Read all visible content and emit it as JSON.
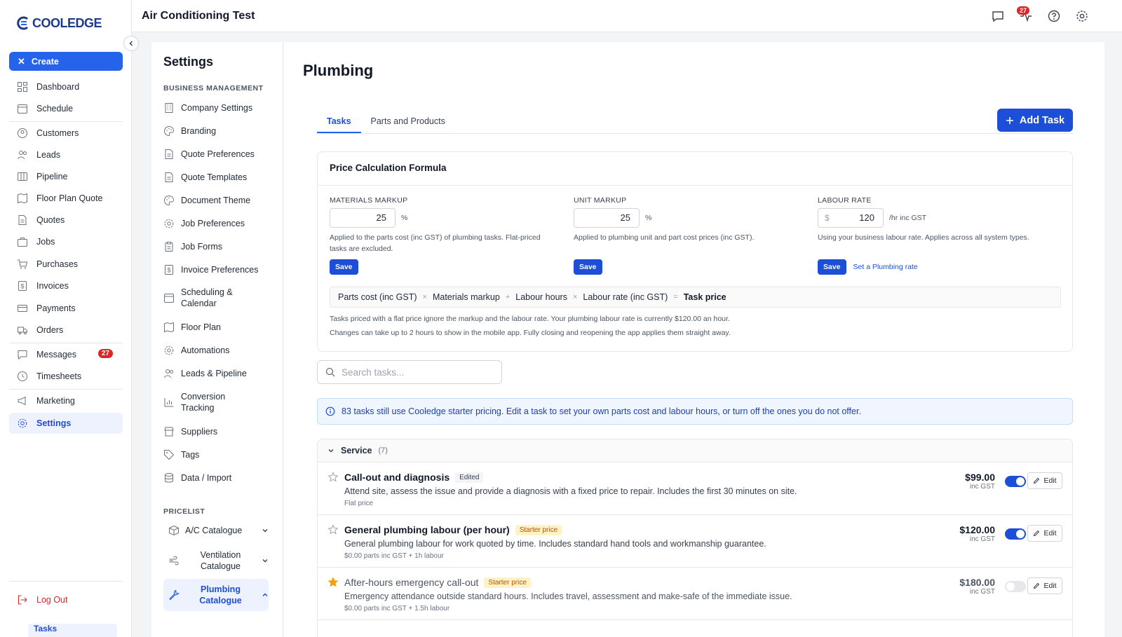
{
  "app": {
    "logo_text": "COOLEDGE",
    "title": "Air Conditioning Test",
    "messages_count": "27"
  },
  "sidebar": {
    "create_label": "Create",
    "items": [
      {
        "label": "Dashboard",
        "icon": "dashboard-icon"
      },
      {
        "label": "Schedule",
        "icon": "calendar-icon"
      },
      {
        "label": "Customers",
        "icon": "user-circle-icon"
      },
      {
        "label": "Leads",
        "icon": "users-icon"
      },
      {
        "label": "Pipeline",
        "icon": "pipeline-icon"
      },
      {
        "label": "Floor Plan Quote",
        "icon": "map-icon"
      },
      {
        "label": "Quotes",
        "icon": "document-icon"
      },
      {
        "label": "Jobs",
        "icon": "briefcase-icon"
      },
      {
        "label": "Purchases",
        "icon": "cart-icon"
      },
      {
        "label": "Invoices",
        "icon": "invoice-icon"
      },
      {
        "label": "Payments",
        "icon": "credit-card-icon"
      },
      {
        "label": "Orders",
        "icon": "truck-icon"
      },
      {
        "label": "Messages",
        "icon": "chat-icon",
        "badge": "27"
      },
      {
        "label": "Timesheets",
        "icon": "clock-icon"
      },
      {
        "label": "Marketing",
        "icon": "megaphone-icon"
      },
      {
        "label": "Settings",
        "icon": "gear-icon"
      }
    ],
    "logout_label": "Log Out"
  },
  "settings_panel": {
    "title": "Settings",
    "business_section": "BUSINESS MANAGEMENT",
    "items": [
      {
        "label": "Company Settings"
      },
      {
        "label": "Branding"
      },
      {
        "label": "Quote Preferences"
      },
      {
        "label": "Quote Templates"
      },
      {
        "label": "Document Theme"
      },
      {
        "label": "Job Preferences"
      },
      {
        "label": "Job Forms"
      },
      {
        "label": "Invoice Preferences"
      },
      {
        "label": "Scheduling & Calendar"
      },
      {
        "label": "Floor Plan"
      },
      {
        "label": "Automations"
      },
      {
        "label": "Leads & Pipeline"
      },
      {
        "label": "Conversion Tracking"
      },
      {
        "label": "Suppliers"
      },
      {
        "label": "Tags"
      },
      {
        "label": "Data / Import"
      }
    ],
    "pricelist_section": "PRICELIST",
    "catalogues": [
      {
        "label": "A/C Catalogue"
      },
      {
        "label": "Ventilation Catalogue"
      },
      {
        "label": "Plumbing Catalogue"
      }
    ],
    "sub_item": "Tasks"
  },
  "main": {
    "title": "Plumbing",
    "tabs": [
      {
        "label": "Tasks"
      },
      {
        "label": "Parts and Products"
      }
    ],
    "add_task_label": "Add Task",
    "formula": {
      "title": "Price Calculation Formula",
      "materials_caption": "MATERIALS MARKUP",
      "materials_value": "25",
      "materials_unit": "%",
      "materials_help": "Applied to the parts cost (inc GST) of plumbing tasks. Flat-priced tasks are excluded.",
      "unit_caption": "UNIT MARKUP",
      "unit_value": "25",
      "unit_unit": "%",
      "unit_help": "Applied to plumbing unit and part cost prices (inc GST).",
      "labour_caption": "LABOUR RATE",
      "labour_prefix": "$",
      "labour_value": "120",
      "labour_unit": "/hr inc GST",
      "labour_help": "Using your business labour rate. Applies across all system types.",
      "save_label": "Save",
      "set_rate_link": "Set a Plumbing rate",
      "terms": [
        "Parts cost (inc GST)",
        "Materials markup",
        "Labour hours",
        "Labour rate (inc GST)",
        "Task price"
      ],
      "ops": [
        "×",
        "+",
        "×",
        "="
      ],
      "note1": "Tasks priced with a flat price ignore the markup and the labour rate. Your plumbing labour rate is currently $120.00 an hour.",
      "note2": "Changes can take up to 2 hours to show in the mobile app. Fully closing and reopening the app applies them straight away."
    },
    "search_placeholder": "Search tasks...",
    "info_banner": "83 tasks still use Cooledge starter pricing. Edit a task to set your own parts cost and labour hours, or turn off the ones you do not offer.",
    "group": {
      "name": "Service",
      "count": "(7)"
    },
    "tasks": [
      {
        "name": "Call-out and diagnosis",
        "tag": "Edited",
        "desc": "Attend site, assess the issue and provide a diagnosis with a fixed price to repair. Includes the first 30 minutes on site.",
        "meta": "Flat price",
        "price": "$99.00",
        "price_sub": "inc GST",
        "enabled": true,
        "starred": false
      },
      {
        "name": "General plumbing labour (per hour)",
        "tag": "Starter price",
        "desc": "General plumbing labour for work quoted by time. Includes standard hand tools and workmanship guarantee.",
        "meta": "$0.00 parts inc GST + 1h labour",
        "price": "$120.00",
        "price_sub": "inc GST",
        "enabled": true,
        "starred": false
      },
      {
        "name": "After-hours emergency call-out",
        "tag": "Starter price",
        "desc": "Emergency attendance outside standard hours. Includes travel, assessment and make-safe of the immediate issue.",
        "meta": "$0.00 parts inc GST + 1.5h labour",
        "price": "$180.00",
        "price_sub": "inc GST",
        "enabled": false,
        "starred": true
      }
    ],
    "edit_label": "Edit"
  },
  "colors": {
    "accent": "#2563eb",
    "badge": "#dc2626",
    "star": "#f59e0b"
  }
}
